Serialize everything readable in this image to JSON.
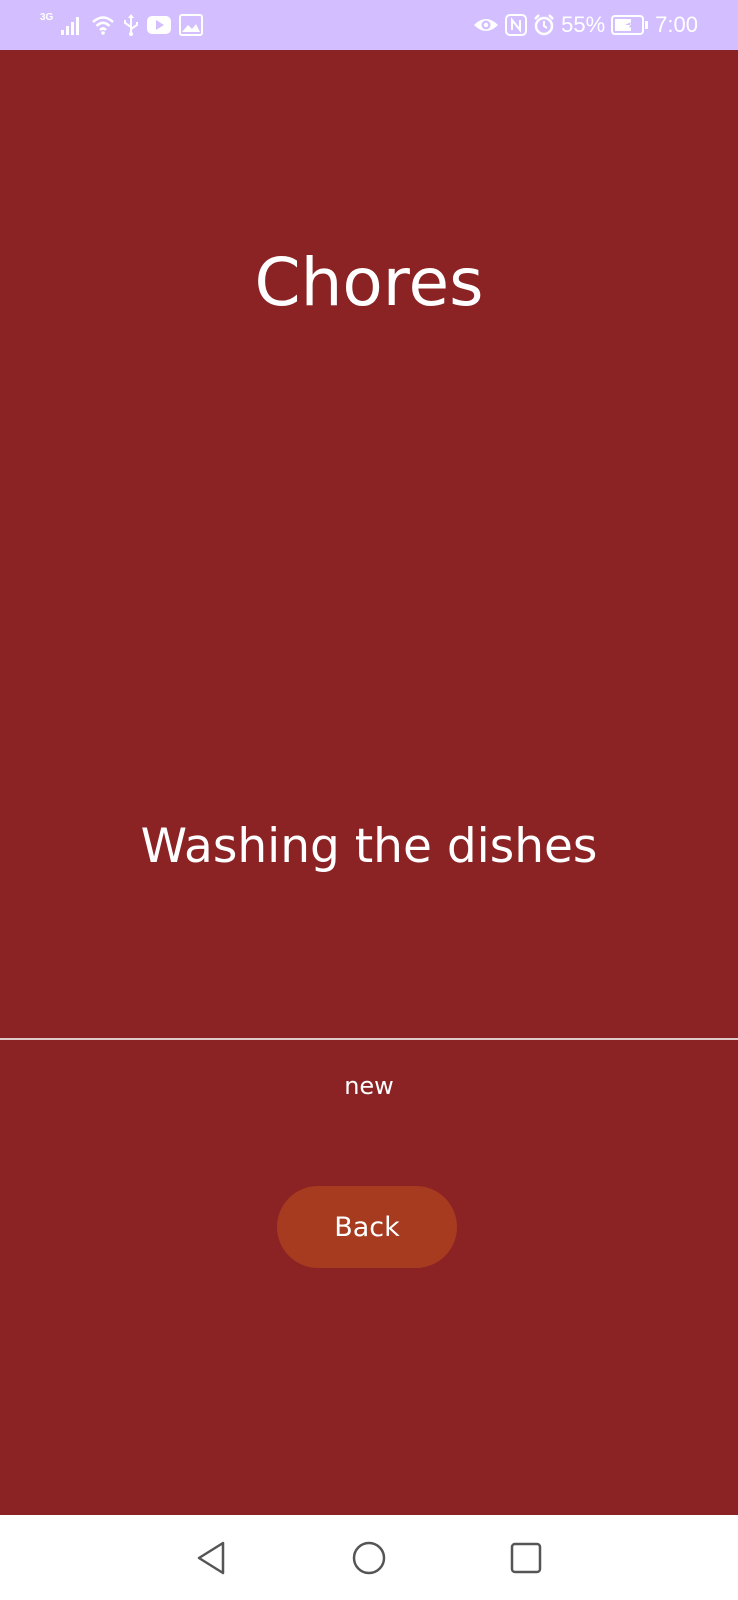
{
  "status_bar": {
    "network_type": "3G",
    "battery_percent": "55%",
    "time": "7:00",
    "background_color": "#d3bfff",
    "left_icons": [
      "signal-icon",
      "wifi-icon",
      "usb-icon",
      "youtube-icon",
      "image-icon"
    ],
    "right_icons": [
      "eye-icon",
      "nfc-icon",
      "alarm-icon",
      "battery-icon"
    ]
  },
  "screen": {
    "title": "Chores",
    "chore_name": "Washing the dishes",
    "chore_status": "new",
    "back_label": "Back",
    "background_color": "#8b2324",
    "button_color": "#a63b20"
  },
  "nav_bar": {
    "icons": [
      "back-triangle-icon",
      "home-circle-icon",
      "recents-square-icon"
    ]
  }
}
